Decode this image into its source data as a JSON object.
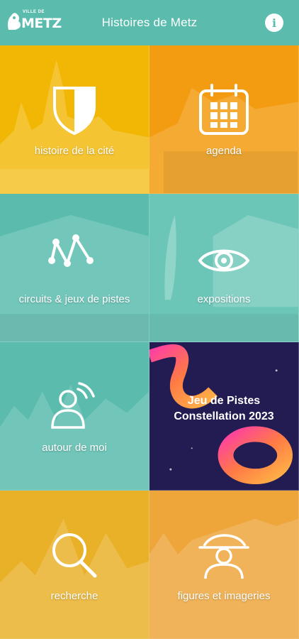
{
  "header": {
    "logo_small": "VILLE DE",
    "logo_main": "METZ",
    "title": "Histoires de Metz",
    "info_icon": "i"
  },
  "tiles": [
    {
      "label": "histoire de la cité",
      "icon": "shield-icon",
      "color": "#f2b705"
    },
    {
      "label": "agenda",
      "icon": "calendar-icon",
      "color": "#f39c12"
    },
    {
      "label": "circuits & jeux de pistes",
      "icon": "route-icon",
      "color": "#5bbcae"
    },
    {
      "label": "expositions",
      "icon": "eye-icon",
      "color": "#6cc6b8"
    },
    {
      "label": "autour de moi",
      "icon": "person-location-icon",
      "color": "#5bbcae"
    },
    {
      "promo_line1": "Jeu de Pistes",
      "promo_line2": "Constellation 2023",
      "color": "#231c52"
    },
    {
      "label": "recherche",
      "icon": "search-icon",
      "color": "#e9b128"
    },
    {
      "label": "figures et imageries",
      "icon": "woman-hat-icon",
      "color": "#eea53a"
    }
  ]
}
